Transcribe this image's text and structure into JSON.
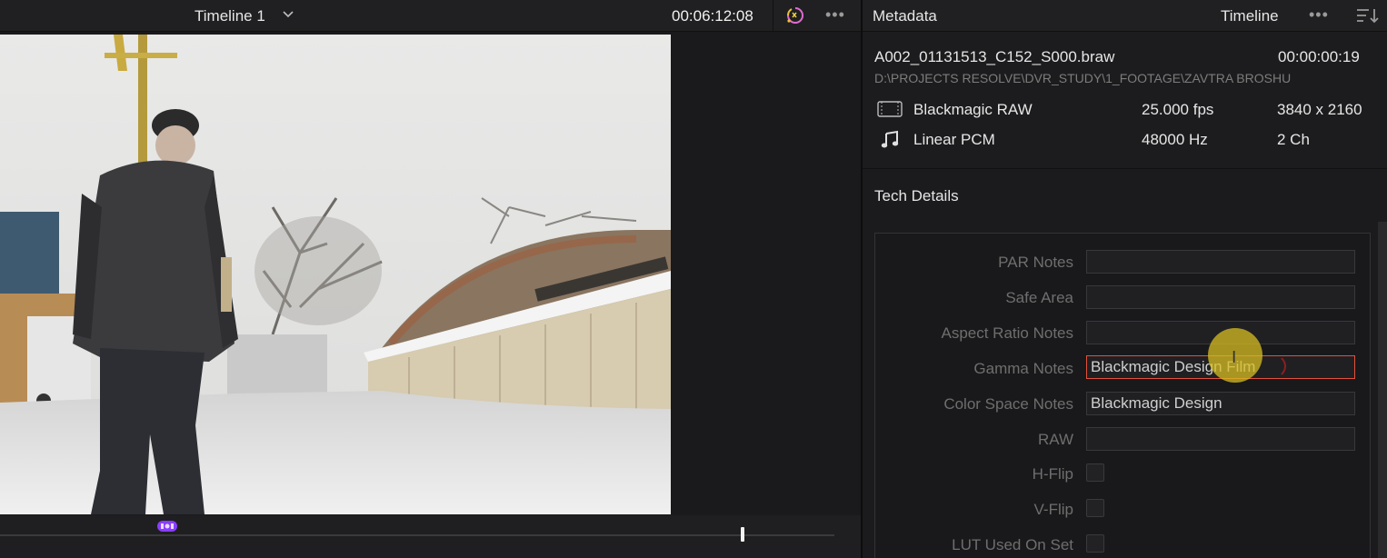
{
  "viewer": {
    "timeline_name": "Timeline 1",
    "timecode": "00:06:12:08"
  },
  "metadata_panel": {
    "title": "Metadata",
    "tab": "Timeline",
    "file_name": "A002_01131513_C152_S000.braw",
    "duration": "00:00:00:19",
    "file_path": "D:\\PROJECTS RESOLVE\\DVR_STUDY\\1_FOOTAGE\\ZAVTRA BROSHU",
    "video": {
      "icon": "film-icon",
      "codec": "Blackmagic RAW",
      "fps": "25.000 fps",
      "resolution": "3840 x 2160"
    },
    "audio": {
      "icon": "music-note-icon",
      "codec": "Linear PCM",
      "sample_rate": "48000 Hz",
      "channels": "2 Ch"
    },
    "section_title": "Tech Details",
    "fields": {
      "par_notes": {
        "label": "PAR Notes",
        "value": ""
      },
      "safe_area": {
        "label": "Safe Area",
        "value": ""
      },
      "aspect_ratio_notes": {
        "label": "Aspect Ratio Notes",
        "value": ""
      },
      "gamma_notes": {
        "label": "Gamma Notes",
        "value": "Blackmagic Design Film"
      },
      "color_space_notes": {
        "label": "Color Space Notes",
        "value": "Blackmagic Design"
      },
      "raw": {
        "label": "RAW",
        "value": ""
      },
      "h_flip": {
        "label": "H-Flip",
        "checked": false
      },
      "v_flip": {
        "label": "V-Flip",
        "checked": false
      },
      "lut_used_on_set": {
        "label": "LUT Used On Set",
        "checked": false
      }
    }
  },
  "colors": {
    "accent_field_border": "#e2523b",
    "cursor_highlight": "#d7be23",
    "marker": "#8a3dff"
  }
}
